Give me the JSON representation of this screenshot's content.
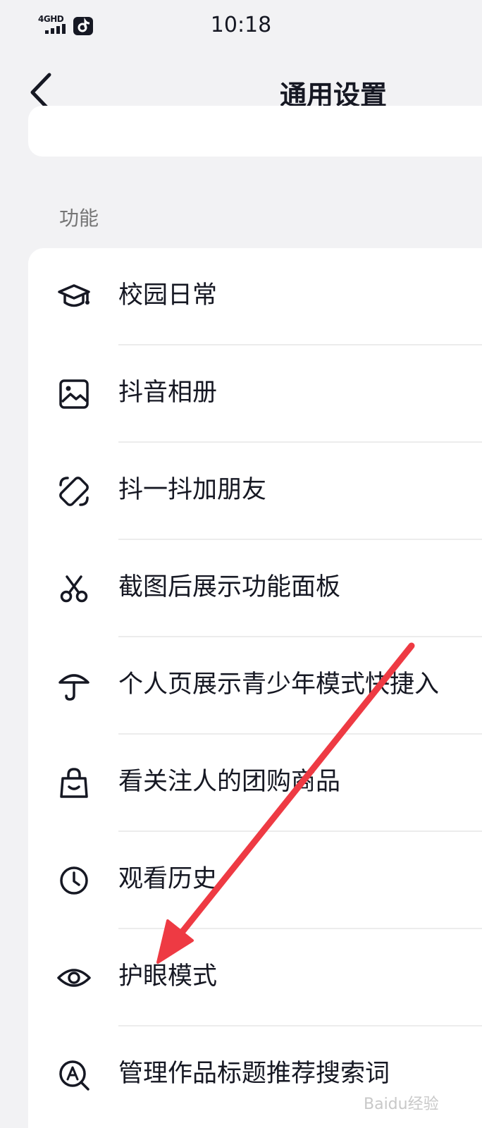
{
  "status_bar": {
    "network": "4GHD",
    "time": "10:18"
  },
  "nav": {
    "title": "通用设置"
  },
  "section": {
    "title": "功能"
  },
  "items": [
    {
      "label": "校园日常",
      "icon": "graduation-cap-icon"
    },
    {
      "label": "抖音相册",
      "icon": "image-icon"
    },
    {
      "label": "抖一抖加朋友",
      "icon": "shake-phone-icon"
    },
    {
      "label": "截图后展示功能面板",
      "icon": "scissors-icon"
    },
    {
      "label": "个人页展示青少年模式快捷入",
      "icon": "umbrella-icon"
    },
    {
      "label": "看关注人的团购商品",
      "icon": "shopping-bag-icon"
    },
    {
      "label": "观看历史",
      "icon": "clock-icon"
    },
    {
      "label": "护眼模式",
      "icon": "eye-icon"
    },
    {
      "label": "管理作品标题推荐搜索词",
      "icon": "search-a-icon"
    }
  ],
  "colors": {
    "background": "#f2f2f4",
    "card": "#ffffff",
    "text": "#161823",
    "annotation_arrow": "#ee3a43"
  },
  "watermark": "Baidu经验"
}
